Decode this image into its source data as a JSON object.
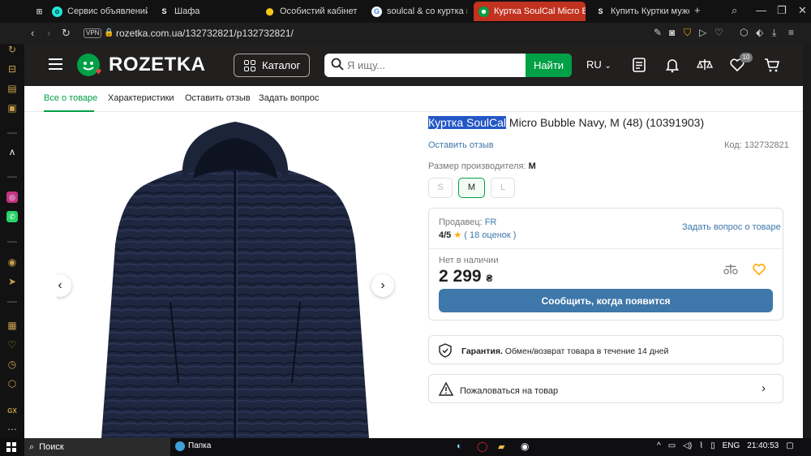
{
  "browser": {
    "tabs": [
      {
        "label": "",
        "icon": "opera-icon"
      },
      {
        "label": "",
        "icon": "gamepad-icon"
      },
      {
        "label": "Сервис объявлений OLX",
        "icon": "olx-icon"
      },
      {
        "label": "Шафа",
        "icon": "shafa-icon"
      },
      {
        "label": "Особистий кабінет | Ук",
        "icon": "location-icon"
      },
      {
        "label": "soulcal & co куртка му",
        "icon": "google-icon"
      },
      {
        "label": "Куртка SoulCal Micro Bub",
        "icon": "rozetka-icon",
        "active": true
      },
      {
        "label": "Купить Куртки мужск",
        "icon": "shafa-icon"
      }
    ],
    "new_tab": "+",
    "url": "rozetka.com.ua/132732821/p132732821/",
    "vpn": "VPN"
  },
  "header": {
    "logo": "ROZETKA",
    "catalog": "Каталог",
    "search_placeholder": "Я ищу...",
    "search_button": "Найти",
    "lang": "RU",
    "wishlist_count": "10"
  },
  "subnav": {
    "tabs": [
      "Все о товаре",
      "Характеристики",
      "Оставить отзыв",
      "Задать вопрос"
    ]
  },
  "product": {
    "title_highlight": "Куртка SoulCal",
    "title_rest": " Micro Bubble Navy, M (48) (10391903)",
    "review_link": "Оставить отзыв",
    "code": "Код: 132732821",
    "size_label": "Размер производителя:",
    "size_value": "M",
    "sizes": [
      "S",
      "M",
      "L"
    ],
    "seller_label": "Продавец:",
    "seller": "FR",
    "rating": "4/5",
    "reviews": "( 18 оценок )",
    "ask_link": "Задать вопрос о товаре",
    "stock": "Нет в наличии",
    "price": "2 299",
    "currency": "₴",
    "notify_button": "Сообщить, когда появится",
    "guarantee_bold": "Гарантия.",
    "guarantee_text": " Обмен/возврат товара в течение 14 дней",
    "complain": "Пожаловаться на товар"
  },
  "taskbar": {
    "search": "Поиск",
    "folder": "Папка",
    "lang": "ENG",
    "time": "21:40:53"
  },
  "colors": {
    "brand_green": "#00a046",
    "link_blue": "#3e77aa",
    "header_dark": "#221f1f",
    "tab_active": "#c1321f",
    "jacket_navy": "#1f2740"
  }
}
